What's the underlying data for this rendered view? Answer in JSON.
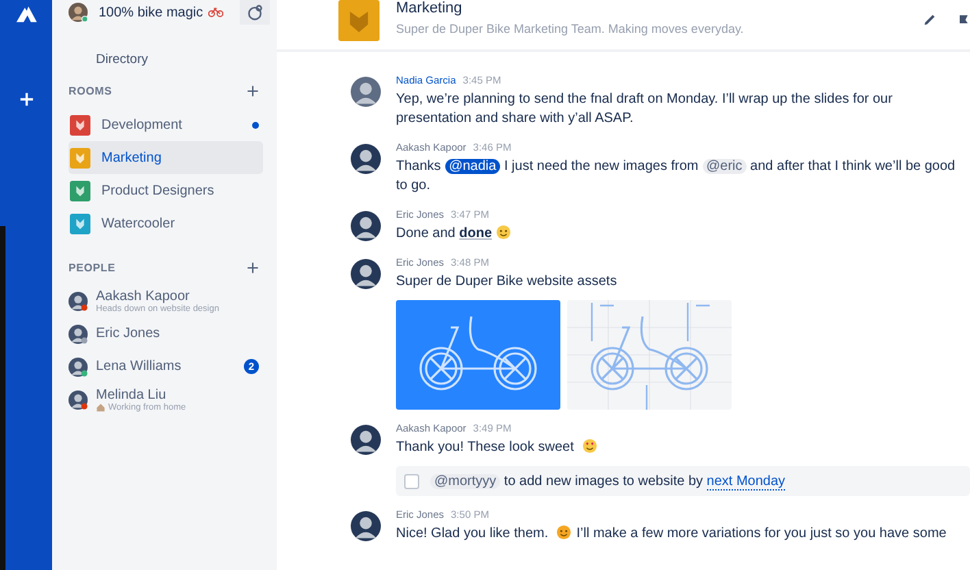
{
  "account": {
    "status": "100% bike magic"
  },
  "sidebar": {
    "directory": "Directory",
    "rooms_heading": "ROOMS",
    "rooms": [
      {
        "name": "Development",
        "color": "#d9443a",
        "unread": true,
        "selected": false
      },
      {
        "name": "Marketing",
        "color": "#e8a317",
        "unread": false,
        "selected": true
      },
      {
        "name": "Product Designers",
        "color": "#2e9e6b",
        "unread": false,
        "selected": false
      },
      {
        "name": "Watercooler",
        "color": "#1fa3c7",
        "unread": false,
        "selected": false
      }
    ],
    "people_heading": "PEOPLE",
    "people": [
      {
        "name": "Aakash Kapoor",
        "status": "Heads down on website design",
        "kind": "plain",
        "color": "#de350b"
      },
      {
        "name": "Eric Jones",
        "kind": "plain",
        "color": "#97a0af"
      },
      {
        "name": "Lena Williams",
        "kind": "plain",
        "color": "#36b37e",
        "badge": "2"
      },
      {
        "name": "Melinda Liu",
        "status": "Working from home",
        "kind": "home",
        "color": "#de350b"
      }
    ]
  },
  "header": {
    "title": "Marketing",
    "description": "Super de Duper Bike Marketing Team. Making moves everyday."
  },
  "messages": [
    {
      "author": "Nadia Garcia",
      "highlight": true,
      "time": "3:45 PM",
      "body": [
        {
          "kind": "text",
          "text": "Yep, we’re planning to send the fnal draft on Monday. I’ll wrap up the slides for our presentation and share with y’all ASAP."
        }
      ]
    },
    {
      "author": "Aakash Kapoor",
      "highlight": false,
      "time": "3:46 PM",
      "body": [
        {
          "kind": "text",
          "text": "Thanks "
        },
        {
          "kind": "mention",
          "text": "@nadia",
          "selected": true
        },
        {
          "kind": "text",
          "text": " I just need the new images from "
        },
        {
          "kind": "mention",
          "text": "@eric",
          "selected": false
        },
        {
          "kind": "text",
          "text": " and after that I think we’ll be good to go."
        }
      ]
    },
    {
      "author": "Eric Jones",
      "highlight": false,
      "time": "3:47 PM",
      "body": [
        {
          "kind": "text",
          "text": "Done and "
        },
        {
          "kind": "bold",
          "text": "done"
        },
        {
          "kind": "wink"
        }
      ]
    },
    {
      "author": "Eric Jones",
      "highlight": false,
      "time": "3:48 PM",
      "body": [
        {
          "kind": "text",
          "text": "Super de Duper Bike website assets"
        }
      ],
      "attachments": [
        {
          "kind": "solid"
        },
        {
          "kind": "blueprint"
        }
      ]
    },
    {
      "author": "Aakash Kapoor",
      "highlight": false,
      "time": "3:49 PM",
      "body": [
        {
          "kind": "text",
          "text": "Thank you! These look sweet "
        },
        {
          "kind": "hearteyes"
        }
      ],
      "task": {
        "checked": false,
        "body": [
          {
            "kind": "mention",
            "text": "@mortyyy",
            "selected": false
          },
          {
            "kind": "text",
            "text": " to add new images to website by "
          },
          {
            "kind": "date",
            "text": "next Monday"
          }
        ]
      }
    },
    {
      "author": "Eric Jones",
      "highlight": false,
      "time": "3:50 PM",
      "body": [
        {
          "kind": "text",
          "text": "Nice! Glad you like them. "
        },
        {
          "kind": "blush"
        },
        {
          "kind": "text",
          "text": " I’ll make a few more variations for you just so you have some"
        }
      ]
    }
  ]
}
